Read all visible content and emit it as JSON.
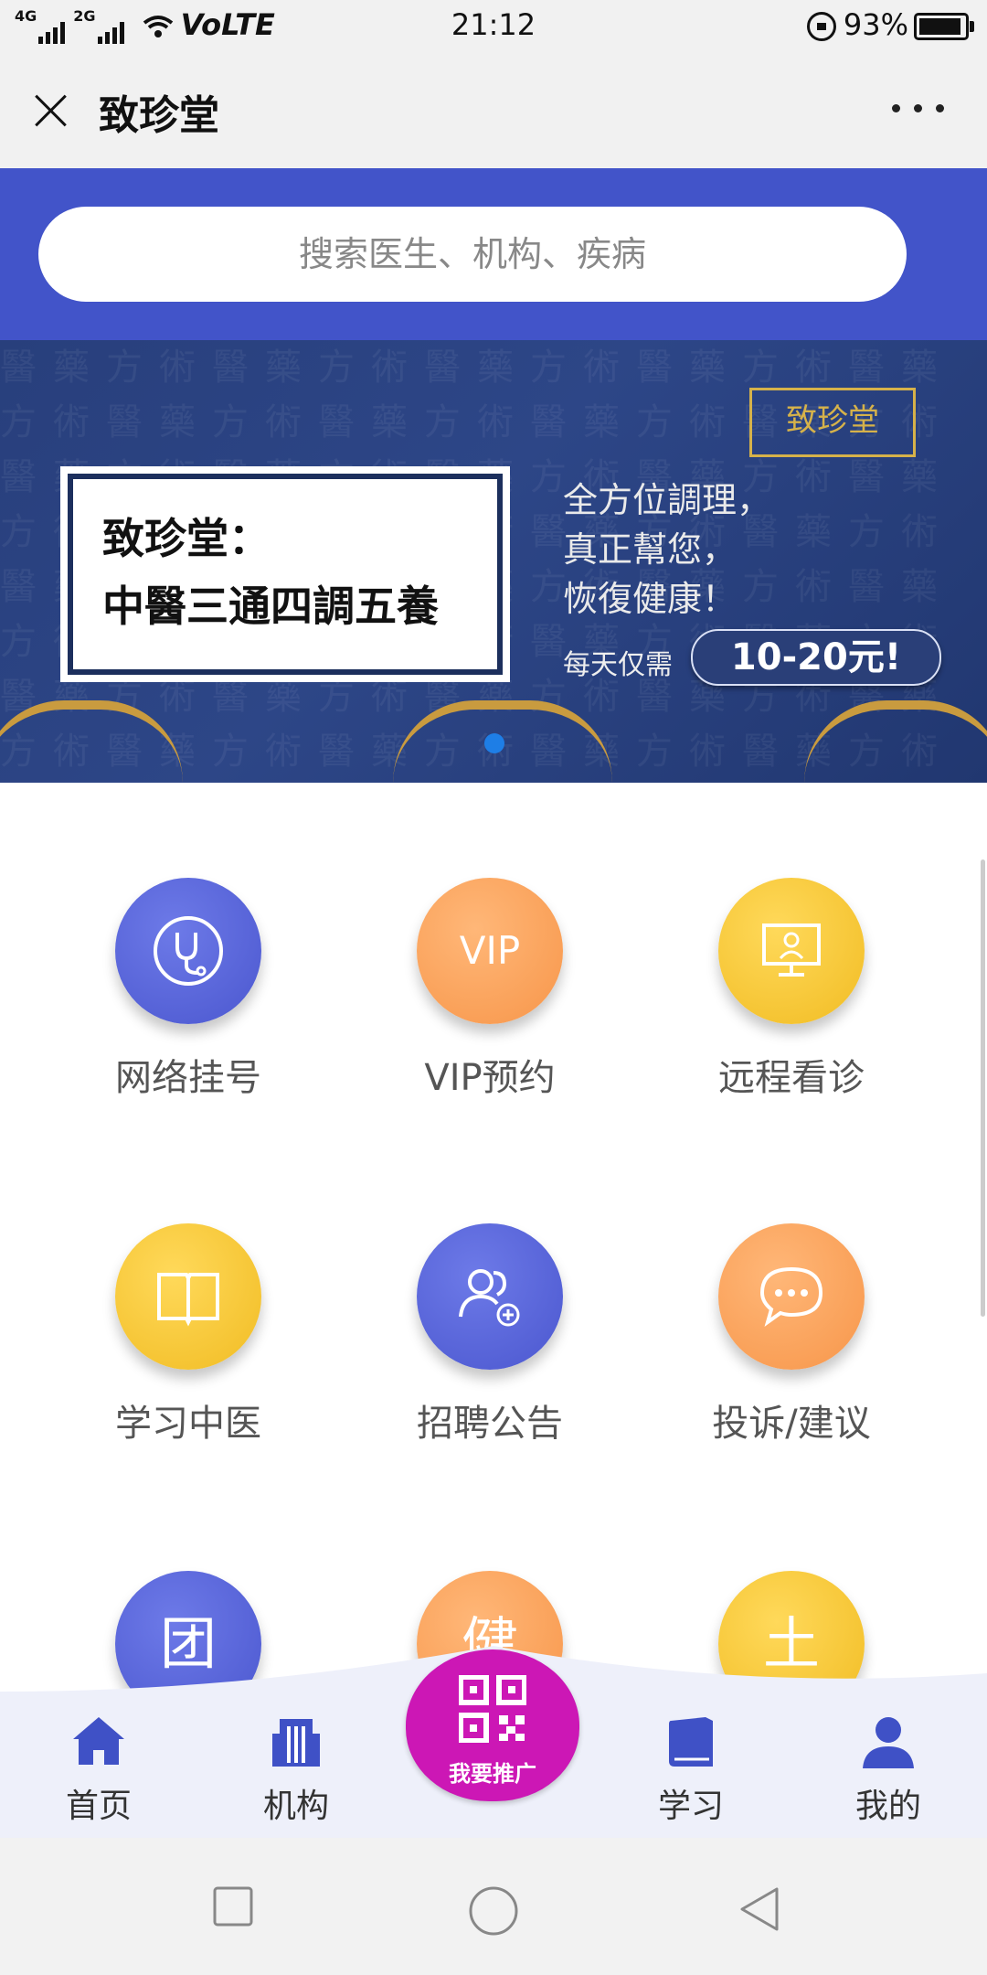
{
  "status_bar": {
    "net1": "4G",
    "net2": "2G",
    "volte": "VoLTE",
    "time": "21:12",
    "battery_text": "93%",
    "battery_level": 0.93
  },
  "title_bar": {
    "title": "致珍堂"
  },
  "search": {
    "placeholder": "搜索医生、机构、疾病"
  },
  "banner": {
    "logo_text": "致珍堂",
    "headline_1": "致珍堂：",
    "headline_2": "中醫三通四調五養",
    "slogan_1": "全方位調理，",
    "slogan_2": "真正幫您，",
    "slogan_3": "恢復健康！",
    "price_label": "每天仅需",
    "price": "10-20元!"
  },
  "grid": [
    {
      "label": "网络挂号",
      "icon": "stethoscope-icon",
      "color": "blue"
    },
    {
      "label": "VIP预约",
      "icon": "vip-icon",
      "glyph": "VIP",
      "color": "orange"
    },
    {
      "label": "远程看诊",
      "icon": "remote-consult-icon",
      "color": "yellow"
    },
    {
      "label": "学习中医",
      "icon": "book-icon",
      "color": "yellow"
    },
    {
      "label": "招聘公告",
      "icon": "add-user-icon",
      "color": "blue"
    },
    {
      "label": "投诉/建议",
      "icon": "chat-icon",
      "color": "orange"
    },
    {
      "glyph": "团",
      "icon": "group-icon",
      "color": "blue"
    },
    {
      "glyph": "健",
      "icon": "health-icon",
      "color": "orange"
    },
    {
      "glyph": "土",
      "icon": "soil-icon",
      "color": "yellow"
    }
  ],
  "bottom_nav": {
    "home": "首页",
    "institutions": "机构",
    "promote": "我要推广",
    "study": "学习",
    "mine": "我的"
  },
  "colors": {
    "accent_blue": "#4254c9",
    "promote_magenta": "#cc17b5",
    "nav_icon_blue": "#3f51c6"
  }
}
